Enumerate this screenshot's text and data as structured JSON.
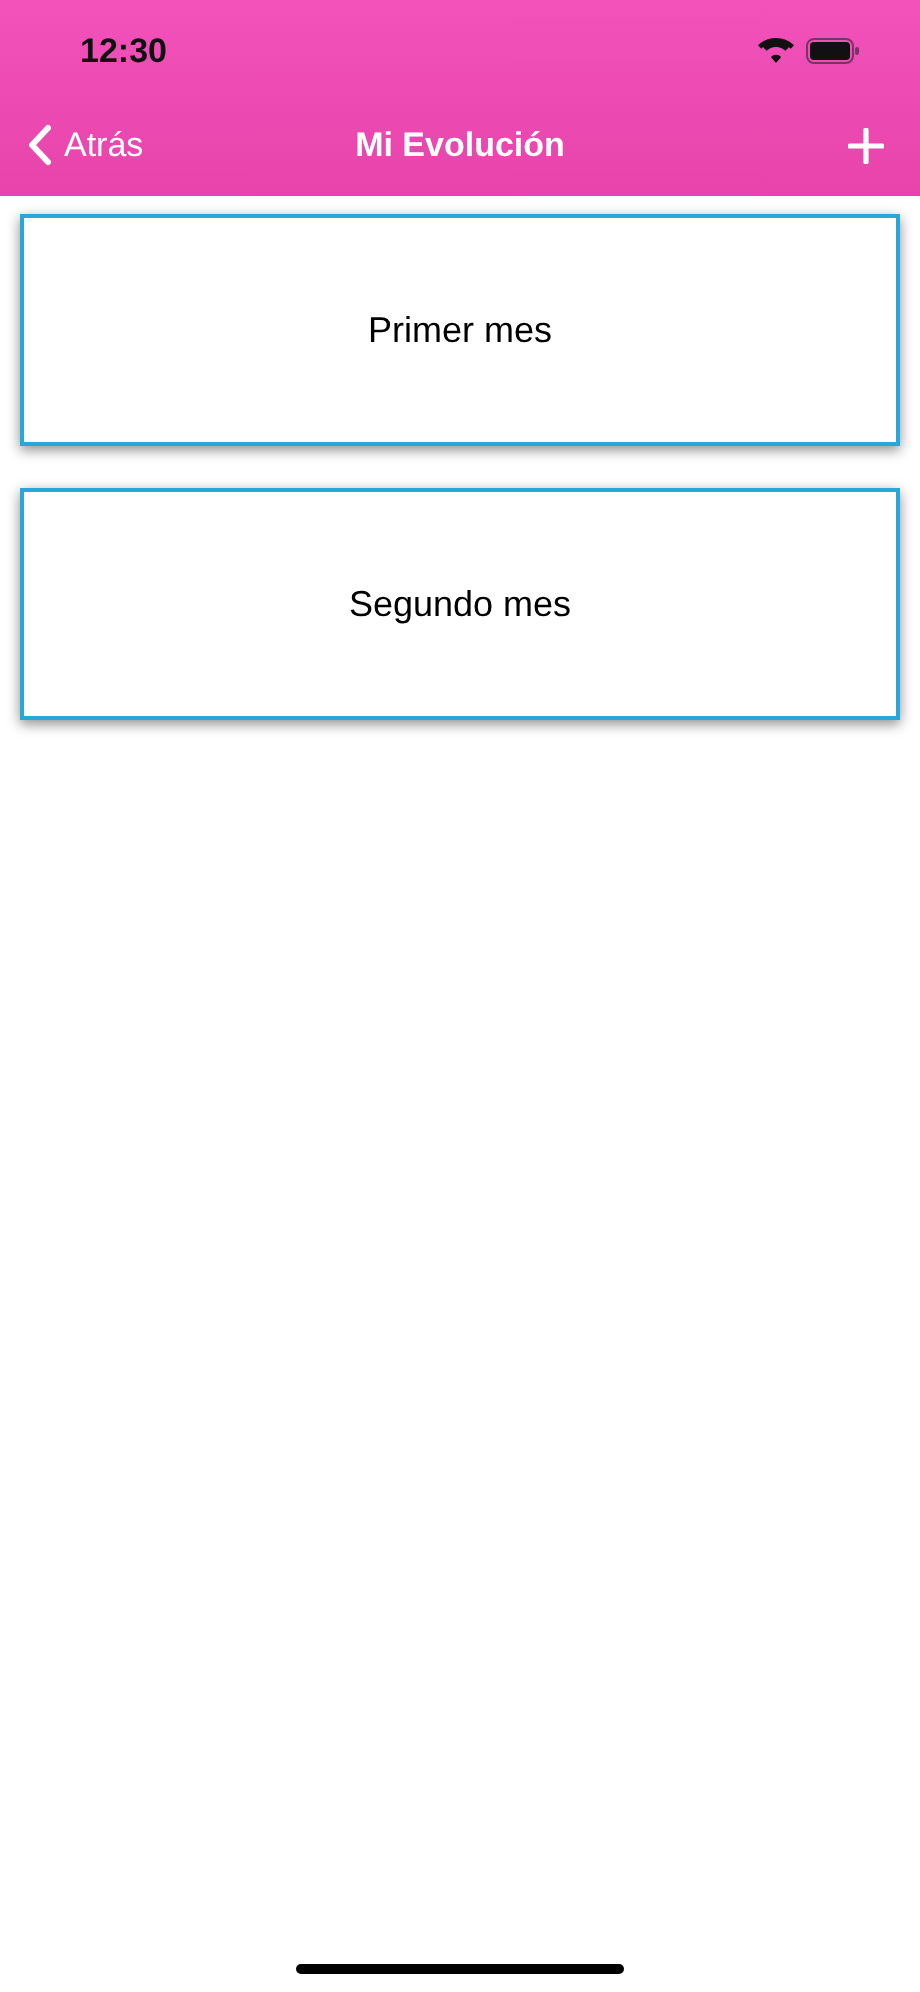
{
  "status_bar": {
    "time": "12:30"
  },
  "nav_bar": {
    "back_label": "Atrás",
    "title": "Mi Evolución"
  },
  "cards": [
    {
      "label": "Primer mes"
    },
    {
      "label": "Segundo mes"
    }
  ]
}
